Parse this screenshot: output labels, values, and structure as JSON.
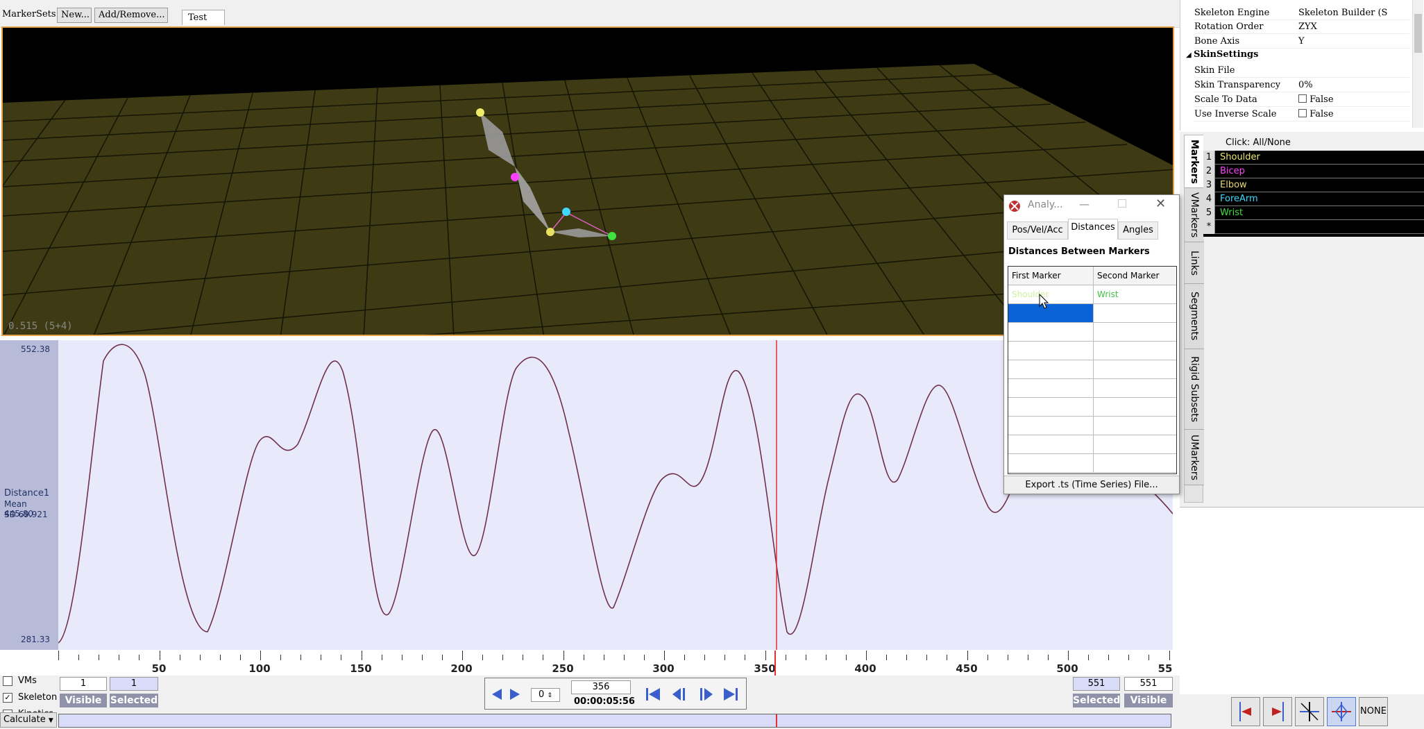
{
  "topbar": {
    "markersets_label": "MarkerSets:",
    "new_button": "New...",
    "add_remove_button": "Add/Remove...",
    "tab_label": "Test"
  },
  "view3d": {
    "readout": "0.515 (5+4)"
  },
  "graph": {
    "ymax_label": "552.38",
    "ymin_label": "281.33",
    "series_name": "Distance1",
    "mean_label": "Mean 445.80",
    "sd_label": "SD  69.921"
  },
  "timeline": {
    "tick_labels": [
      "50",
      "100",
      "150",
      "200",
      "250",
      "300",
      "350",
      "400",
      "450",
      "500",
      "55"
    ],
    "current_frame": 356,
    "total_frames": 551
  },
  "bottom": {
    "vms_label": "VMs",
    "skeleton_label": "Skeleton",
    "kinetics_label": "Kinetics",
    "skeleton_checked": true,
    "start_visible": "1",
    "start_selected": "1",
    "end_selected": "551",
    "end_visible": "551",
    "visible_label": "Visible",
    "selected_label": "Selected",
    "calculate_label": "Calculate",
    "step_value": "0",
    "frame_value": "356",
    "timecode": "00:00:05:56"
  },
  "properties": {
    "rows": [
      {
        "key": "Skeleton Engine",
        "value": "Skeleton Builder (S"
      },
      {
        "key": "Rotation Order",
        "value": "ZYX"
      },
      {
        "key": "Bone Axis",
        "value": "Y"
      }
    ],
    "section": "SkinSettings",
    "skin_rows": [
      {
        "key": "Skin File",
        "value": ""
      },
      {
        "key": "Skin Transparency",
        "value": "0%"
      },
      {
        "key": "Scale To Data",
        "value": "False"
      },
      {
        "key": "Use Inverse Scale",
        "value": "False"
      }
    ]
  },
  "markers": {
    "header": "Click: All/None",
    "items": [
      {
        "num": "1",
        "name": "Shoulder",
        "color": "#e8e870"
      },
      {
        "num": "2",
        "name": "Bicep",
        "color": "#ff44ff"
      },
      {
        "num": "3",
        "name": "Elbow",
        "color": "#e8d870"
      },
      {
        "num": "4",
        "name": "ForeArm",
        "color": "#40d8ff"
      },
      {
        "num": "5",
        "name": "Wrist",
        "color": "#40e040"
      },
      {
        "num": "*",
        "name": "",
        "color": "#ffffff"
      }
    ],
    "tabs": [
      "Markers",
      "VMarkers",
      "Links",
      "Segments",
      "Rigid Subsets",
      "UMarkers"
    ]
  },
  "dialog": {
    "title": "Analy...",
    "tabs": [
      "Pos/Vel/Acc",
      "Distances",
      "Angles"
    ],
    "heading": "Distances Between Markers",
    "col1": "First Marker",
    "col2": "Second Marker",
    "first_marker": "Shoulder",
    "second_marker": "Wrist",
    "export_button": "Export .ts (Time Series) File..."
  },
  "toolbar": {
    "none_label": "NONE"
  }
}
